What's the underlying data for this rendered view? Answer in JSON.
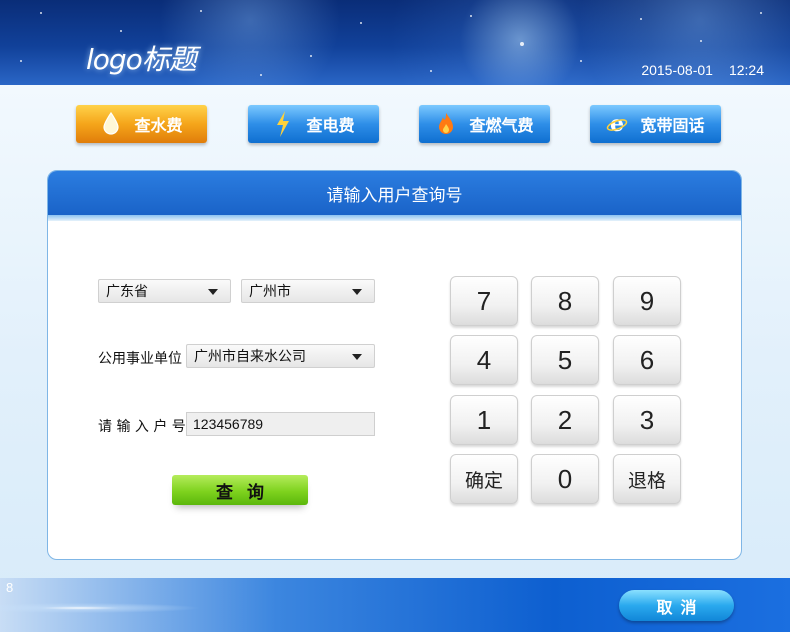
{
  "header": {
    "logo": "logo标题",
    "date": "2015-08-01",
    "time": "12:24"
  },
  "services": [
    {
      "label": "查水费",
      "icon": "water-drop-icon",
      "color": "#f5a51a"
    },
    {
      "label": "查电费",
      "icon": "lightning-icon",
      "color": "#2e8ee8"
    },
    {
      "label": "查燃气费",
      "icon": "flame-icon",
      "color": "#2e8ee8"
    },
    {
      "label": "宽带固话",
      "icon": "browser-e-icon",
      "color": "#2e8ee8"
    }
  ],
  "panel": {
    "title": "请输入用户查询号",
    "province": "广东省",
    "city": "广州市",
    "unit_label": "公用事业单位",
    "unit_value": "广州市自来水公司",
    "account_label": "请 输 入 户 号",
    "account_value": "123456789",
    "query_button": "查询"
  },
  "keypad": {
    "keys": [
      "7",
      "8",
      "9",
      "4",
      "5",
      "6",
      "1",
      "2",
      "3",
      "确定",
      "0",
      "退格"
    ]
  },
  "footer": {
    "side_mark": "8",
    "cancel_button": "取消"
  }
}
